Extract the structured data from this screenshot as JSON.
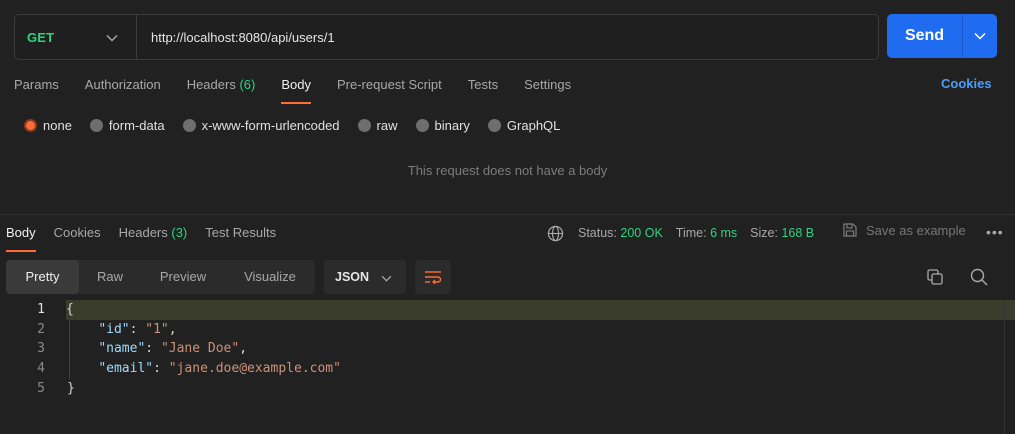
{
  "request": {
    "method": "GET",
    "url": "http://localhost:8080/api/users/1",
    "send_label": "Send"
  },
  "request_tabs": [
    {
      "label": "Params"
    },
    {
      "label": "Authorization"
    },
    {
      "label": "Headers",
      "count": "(6)"
    },
    {
      "label": "Body",
      "active": true
    },
    {
      "label": "Pre-request Script"
    },
    {
      "label": "Tests"
    },
    {
      "label": "Settings"
    }
  ],
  "cookies_label": "Cookies",
  "body_types": [
    {
      "label": "none",
      "selected": true
    },
    {
      "label": "form-data"
    },
    {
      "label": "x-www-form-urlencoded"
    },
    {
      "label": "raw"
    },
    {
      "label": "binary"
    },
    {
      "label": "GraphQL"
    }
  ],
  "no_body_message": "This request does not have a body",
  "response": {
    "tabs": [
      {
        "label": "Body",
        "active": true
      },
      {
        "label": "Cookies"
      },
      {
        "label": "Headers",
        "count": "(3)"
      },
      {
        "label": "Test Results"
      }
    ],
    "status_label": "Status:",
    "status_value": "200 OK",
    "time_label": "Time:",
    "time_value": "6 ms",
    "size_label": "Size:",
    "size_value": "168 B",
    "save_label": "Save as example",
    "view_modes": [
      "Pretty",
      "Raw",
      "Preview",
      "Visualize"
    ],
    "format": "JSON",
    "code_lines": [
      {
        "n": "1",
        "text": "{"
      },
      {
        "n": "2",
        "key": "\"id\"",
        "value": "\"1\"",
        "sep": ","
      },
      {
        "n": "3",
        "key": "\"name\"",
        "value": "\"Jane Doe\"",
        "sep": ","
      },
      {
        "n": "4",
        "key": "\"email\"",
        "value": "\"jane.doe@example.com\"",
        "sep": ""
      },
      {
        "n": "5",
        "text": "}"
      }
    ]
  },
  "colors": {
    "accent": "#ff6c37",
    "send": "#1f6cf0",
    "method": "#2cd47e",
    "link": "#4d9ef7"
  },
  "icons": [
    "chevron-down-icon",
    "globe-icon",
    "save-icon",
    "more-icon",
    "wrap-icon",
    "copy-icon",
    "search-icon"
  ]
}
